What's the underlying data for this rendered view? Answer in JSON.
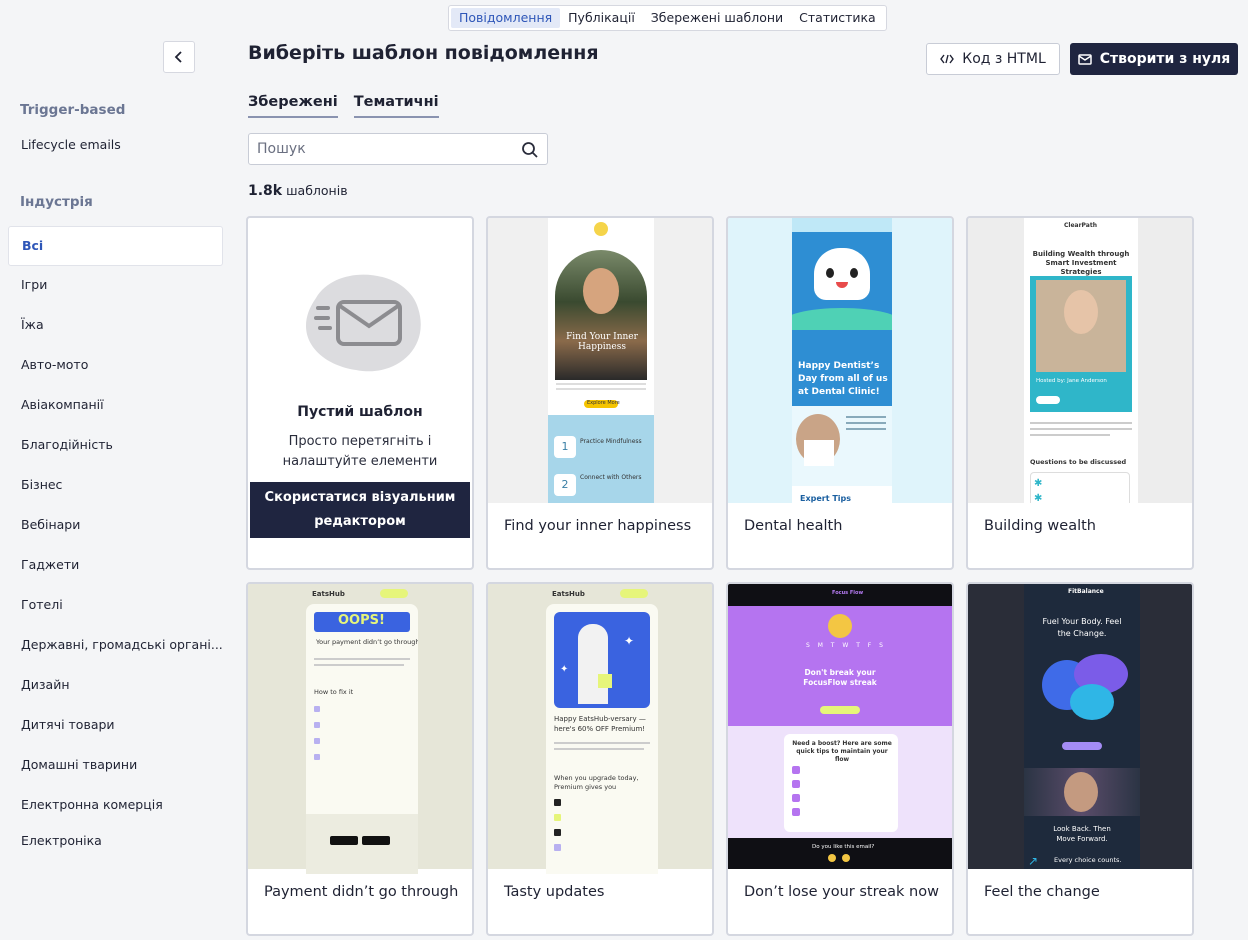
{
  "top_tabs": [
    "Повідомлення",
    "Публікації",
    "Збережені шаблони",
    "Статистика"
  ],
  "sidebar": {
    "section1": "Trigger-based",
    "item1": "Lifecycle emails",
    "section2": "Індустрія",
    "items": [
      "Всі",
      "Ігри",
      "Їжа",
      "Авто-мото",
      "Авіакомпанії",
      "Благодійність",
      "Бізнес",
      "Вебінари",
      "Гаджети",
      "Готелі",
      "Державні, громадські органі...",
      "Дизайн",
      "Дитячі товари",
      "Домашні тварини",
      "Електронна комерція",
      "Електроніка"
    ]
  },
  "header": {
    "title": "Виберіть шаблон повідомлення",
    "html_button": "Код з HTML",
    "create_button": "Створити з нуля"
  },
  "subtabs": [
    "Збережені",
    "Тематичні"
  ],
  "search": {
    "placeholder": "Пошук"
  },
  "count": {
    "number": "1.8k",
    "label": "шаблонів"
  },
  "blank": {
    "title": "Пустий шаблон",
    "desc": "Просто перетягніть і налаштуйте елементи",
    "button": "Скористатися візуальним редактором"
  },
  "cards": [
    "Find your inner happiness",
    "Dental health",
    "Building wealth",
    "Payment didn’t go through",
    "Tasty updates",
    "Don’t lose your streak now",
    "Feel the change"
  ],
  "previews": {
    "happiness": {
      "headline": "Find Your Inner Happiness",
      "btn": "Explore More",
      "tips": "Practice Mindfulness",
      "tips2": "Connect with Others"
    },
    "dental": {
      "headline": "Happy Dentist’s Day from all of us at Dental Clinic!",
      "footer": "Expert Tips"
    },
    "wealth": {
      "brand": "ClearPath",
      "title": "Building Wealth through Smart Investment Strategies",
      "host": "Hosted by: Jane Anderson",
      "q": "Questions to be discussed"
    },
    "payment": {
      "brand": "EatsHub",
      "oops": "OOPS!",
      "line": "Your payment didn’t go through",
      "how": "How to fix it"
    },
    "tasty": {
      "brand": "EatsHub",
      "line": "Happy EatsHub-versary — here's 60% OFF Premium!",
      "line2": "When you upgrade today, Premium gives you"
    },
    "streak": {
      "brand": "Focus Flow",
      "days": "S M T W T F S",
      "line": "Don't break your FocusFlow streak",
      "boost": "Need a boost? Here are some quick tips to maintain your flow",
      "like": "Do you like this email?"
    },
    "fit": {
      "brand": "FitBalance",
      "line": "Fuel Your Body. Feel the Change.",
      "line2": "Look Back. Then Move Forward.",
      "line3": "Every choice counts."
    }
  },
  "colors": {
    "accent": "#2e56b8",
    "dark": "#1f2540"
  }
}
